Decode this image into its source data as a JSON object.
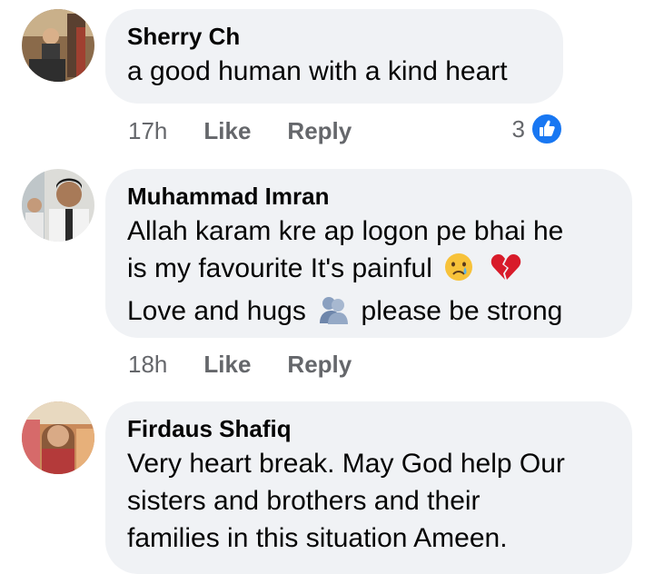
{
  "comments": [
    {
      "author": "Sherry Ch",
      "text": "a good human with a kind heart",
      "time": "17h",
      "like": "Like",
      "reply": "Reply",
      "reaction_count": "3"
    },
    {
      "author": "Muhammad Imran",
      "line1": "Allah karam kre ap logon pe bhai he",
      "line2": "is my favourite It's painful",
      "line3a": "Love and hugs",
      "line3b": "please be strong",
      "time": "18h",
      "like": "Like",
      "reply": "Reply"
    },
    {
      "author": "Firdaus Shafiq",
      "line1": "Very heart break. May God help Our",
      "line2": "sisters and brothers and their",
      "line3": "families in this situation Ameen."
    }
  ],
  "icons": {
    "like_badge": "thumbs-up-icon",
    "emoji_sad": "crying-face-icon",
    "emoji_broken_heart": "broken-heart-icon",
    "emoji_hug": "people-hugging-icon"
  },
  "colors": {
    "bubble": "#f0f2f5",
    "meta_text": "#65676b",
    "like_blue": "#1877f2"
  }
}
